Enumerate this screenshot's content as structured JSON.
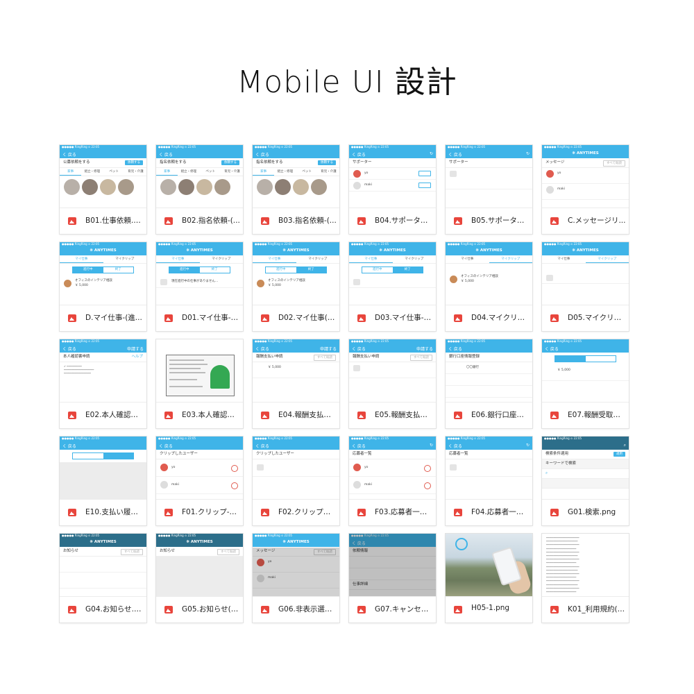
{
  "page": {
    "title": "Mobile UI 設計"
  },
  "mock": {
    "carrier": "●●●●● RingRing ⊙ 22:05",
    "back": "く 戻る",
    "brand": "❋ ANYTIMES",
    "request_job": "公募依頼をする",
    "request_named": "指名依頼をする",
    "request_btn": "依頼する",
    "categories": [
      "家事",
      "組立・修理",
      "ペット",
      "育児・介護"
    ],
    "supporter": "サポーター",
    "select": "選択",
    "message": "メッセージ",
    "all_read": "すべて既読",
    "my_job": "マイ仕事",
    "my_clip": "マイクリップ",
    "in_progress": "進行中",
    "done": "終了",
    "job_title": "オフィスのインテリア相談",
    "job_price": "￥ 5,000",
    "no_job": "現在進行中の仕事がありません…",
    "apply": "申請する",
    "identity": "本人確認書申請",
    "help": "ヘルプ",
    "reward_request": "報酬支払い申請",
    "bank": "銀行口座情報登録",
    "bank_name": "〇〇銀行",
    "clipped_users": "クリップしたユーザー",
    "applicants": "応募者一覧",
    "search_cond": "検索条件適用",
    "apply_btn": "適用",
    "keyword": "キーワードで検索",
    "notice": "お知らせ",
    "request_info": "依頼情報",
    "job_detail": "仕事詳細",
    "user_yo": "yo",
    "user_maki": "maki"
  },
  "cards": [
    {
      "id": "c1",
      "name": "B01.仕事依頼.pn..."
    },
    {
      "id": "c2",
      "name": "B02.指名依頼-(..."
    },
    {
      "id": "c3",
      "name": "B03.指名依頼-(..."
    },
    {
      "id": "c4",
      "name": "B04.サポーター..."
    },
    {
      "id": "c5",
      "name": "B05.サポーター..."
    },
    {
      "id": "c6",
      "name": "C.メッセージリ..."
    },
    {
      "id": "c7",
      "name": "D.マイ仕事-(進..."
    },
    {
      "id": "c8",
      "name": "D01.マイ仕事-(..."
    },
    {
      "id": "c9",
      "name": "D02.マイ仕事(終..."
    },
    {
      "id": "c10",
      "name": "D03.マイ仕事-(..."
    },
    {
      "id": "c11",
      "name": "D04.マイクリッ..."
    },
    {
      "id": "c12",
      "name": "D05.マイクリッ..."
    },
    {
      "id": "c13",
      "name": "E02.本人確認書(..."
    },
    {
      "id": "c14",
      "name": "E03.本人確認書(..."
    },
    {
      "id": "c15",
      "name": "E04.報酬支払い..."
    },
    {
      "id": "c16",
      "name": "E05.報酬支払い..."
    },
    {
      "id": "c17",
      "name": "E06.銀行口座情..."
    },
    {
      "id": "c18",
      "name": "E07.報酬受取履..."
    },
    {
      "id": "c19",
      "name": "E10.支払い履歴(..."
    },
    {
      "id": "c20",
      "name": "F01.クリップ-ユ..."
    },
    {
      "id": "c21",
      "name": "F02.クリップユ..."
    },
    {
      "id": "c22",
      "name": "F03.応募者一覧..."
    },
    {
      "id": "c23",
      "name": "F04.応募者一覧-..."
    },
    {
      "id": "c24",
      "name": "G01.検索.png"
    },
    {
      "id": "c25",
      "name": "G04.お知らせ.p..."
    },
    {
      "id": "c26",
      "name": "G05.お知らせ(空..."
    },
    {
      "id": "c27",
      "name": "G06.非表示選択-..."
    },
    {
      "id": "c28",
      "name": "G07.キャンセル..."
    },
    {
      "id": "c29",
      "name": "H05-1.png"
    },
    {
      "id": "c30",
      "name": "K01_利用規約(W..."
    }
  ],
  "colors": {
    "accent": "#3fb4e8",
    "icon": "#e8453c",
    "dark_nav": "#2c6e8a"
  },
  "icons": {
    "file": "image-file-icon"
  }
}
